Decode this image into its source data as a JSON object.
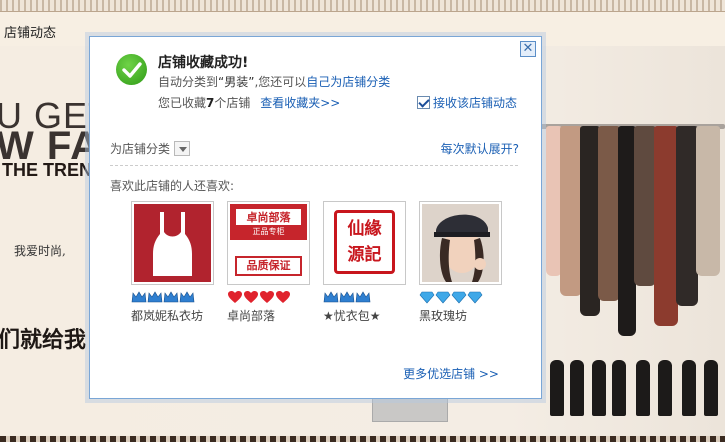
{
  "shop": {
    "nav_tab": "店铺动态",
    "hero_line1": "U GET",
    "hero_line2": "W FA",
    "hero_line3": "THE TREN",
    "hero_line4": "我爱时尚,",
    "hero_line5": "们就给我"
  },
  "dialog": {
    "close_glyph": "✕",
    "title": "店铺收藏成功!",
    "auto_prefix": "自动分类到",
    "auto_category": "“男装”",
    "auto_middle": ",您还可以",
    "custom_category_link": "自己为店铺分类",
    "collected_prefix": "您已收藏",
    "collected_count": "7",
    "collected_suffix": "个店铺",
    "view_favorites_link": "查看收藏夹>>",
    "receive_updates_label": "接收该店铺动态",
    "receive_updates_checked": true,
    "category_label": "为店铺分类",
    "expand_default_link": "每次默认展开?",
    "also_like_label": "喜欢此店铺的人还喜欢:",
    "more_stores_link": "更多优选店铺 >>",
    "accent_color": "#1a5fb4",
    "stores": [
      {
        "name": "都岚妮私衣坊",
        "badge_type": "blue-crown",
        "badge_count": 4
      },
      {
        "name": "卓尚部落",
        "badge_type": "red-heart",
        "badge_count": 4,
        "logo_line1": "卓尚部落",
        "logo_line2": "正品专柜",
        "logo_line3": "品质保证"
      },
      {
        "name": "★忧衣包★",
        "badge_type": "blue-crown",
        "badge_count": 3,
        "seal_text": "仙緣源記"
      },
      {
        "name": "黑玫瑰坊",
        "badge_type": "blue-diamond",
        "badge_count": 4
      }
    ]
  }
}
